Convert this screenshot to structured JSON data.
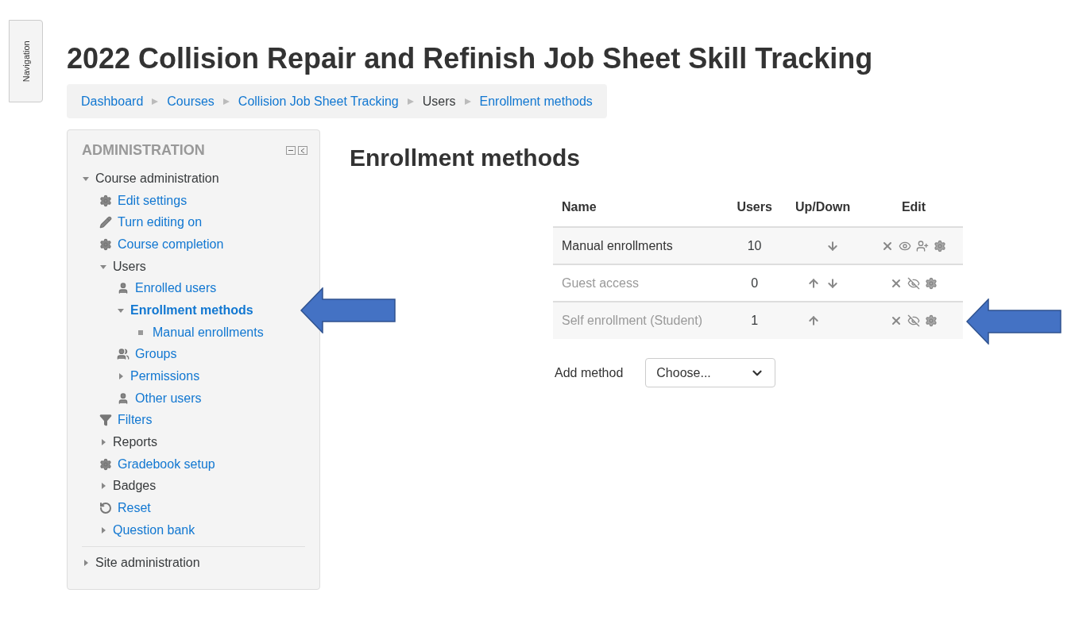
{
  "drawer_tab": {
    "label": "Navigation"
  },
  "page_title": "2022 Collision Repair and Refinish Job Sheet Skill Tracking",
  "breadcrumb": [
    {
      "label": "Dashboard",
      "link": true
    },
    {
      "label": "Courses",
      "link": true
    },
    {
      "label": "Collision Job Sheet Tracking",
      "link": true
    },
    {
      "label": "Users",
      "link": false
    },
    {
      "label": "Enrollment methods",
      "link": true
    }
  ],
  "admin_block": {
    "title": "ADMINISTRATION",
    "tree": [
      {
        "label": "Course administration",
        "kind": "caret",
        "link": false,
        "expanded": true,
        "selected": false,
        "children": [
          {
            "label": "Edit settings",
            "kind": "gear",
            "link": true,
            "selected": false
          },
          {
            "label": "Turn editing on",
            "kind": "pencil",
            "link": true,
            "selected": false
          },
          {
            "label": "Course completion",
            "kind": "gear",
            "link": true,
            "selected": false
          },
          {
            "label": "Users",
            "kind": "caret",
            "link": false,
            "expanded": true,
            "selected": false,
            "children": [
              {
                "label": "Enrolled users",
                "kind": "user",
                "link": true,
                "selected": false
              },
              {
                "label": "Enrollment methods",
                "kind": "caret",
                "link": true,
                "expanded": true,
                "selected": true,
                "children": [
                  {
                    "label": "Manual enrollments",
                    "kind": "bullet",
                    "link": true,
                    "selected": false
                  }
                ]
              },
              {
                "label": "Groups",
                "kind": "group",
                "link": true,
                "selected": false
              },
              {
                "label": "Permissions",
                "kind": "caret",
                "link": true,
                "expanded": false,
                "selected": false
              },
              {
                "label": "Other users",
                "kind": "user",
                "link": true,
                "selected": false
              }
            ]
          },
          {
            "label": "Filters",
            "kind": "filter",
            "link": true,
            "selected": false
          },
          {
            "label": "Reports",
            "kind": "caret",
            "link": false,
            "expanded": false,
            "selected": false
          },
          {
            "label": "Gradebook setup",
            "kind": "gear",
            "link": true,
            "selected": false
          },
          {
            "label": "Badges",
            "kind": "caret",
            "link": false,
            "expanded": false,
            "selected": false
          },
          {
            "label": "Reset",
            "kind": "reset",
            "link": true,
            "selected": false
          },
          {
            "label": "Question bank",
            "kind": "caret",
            "link": true,
            "expanded": false,
            "selected": false
          }
        ]
      }
    ],
    "site_tree": [
      {
        "label": "Site administration",
        "kind": "caret",
        "link": false,
        "expanded": false,
        "selected": false
      }
    ]
  },
  "main": {
    "heading": "Enrollment methods",
    "table": {
      "columns": [
        "Name",
        "Users",
        "Up/Down",
        "Edit"
      ],
      "rows": [
        {
          "name": "Manual enrollments",
          "users": "10",
          "enabled": true,
          "up": false,
          "down": true,
          "enrol_users": true
        },
        {
          "name": "Guest access",
          "users": "0",
          "enabled": false,
          "up": true,
          "down": true,
          "enrol_users": false
        },
        {
          "name": "Self enrollment (Student)",
          "users": "1",
          "enabled": false,
          "up": true,
          "down": false,
          "enrol_users": false
        }
      ]
    },
    "add_method": {
      "label": "Add method",
      "value": "Choose..."
    }
  }
}
